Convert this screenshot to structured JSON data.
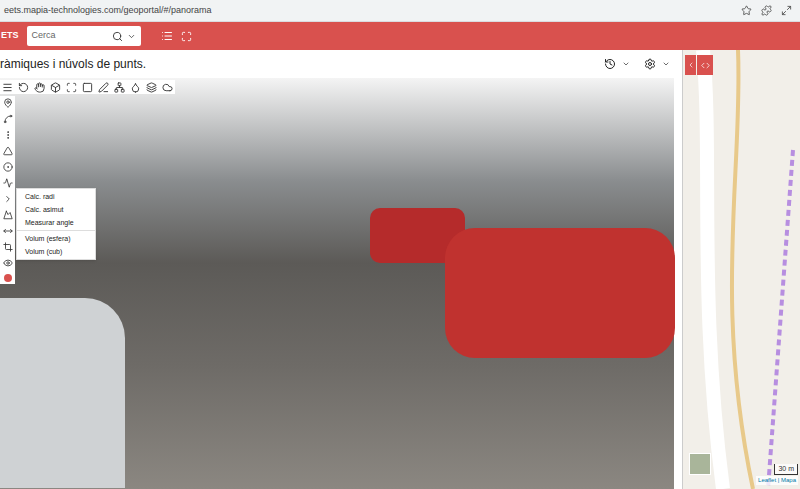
{
  "browser": {
    "url": "eets.mapia-technologies.com/geoportal/#/panorama"
  },
  "header": {
    "brand": "ETS",
    "search": {
      "placeholder": "Cerca"
    }
  },
  "page": {
    "title": "ràmiques i núvols de punts."
  },
  "measure_menu": {
    "items": [
      {
        "kind": "item",
        "label": "Calc. radi"
      },
      {
        "kind": "item",
        "label": "Calc. asimut"
      },
      {
        "kind": "item",
        "label": "Measurar angle"
      },
      {
        "kind": "separator"
      },
      {
        "kind": "item",
        "label": "Volum (esfera)"
      },
      {
        "kind": "item",
        "label": "Volum (cub)"
      }
    ]
  },
  "map": {
    "scale": "30 m",
    "attribution": "Leaflet | Mapa"
  }
}
